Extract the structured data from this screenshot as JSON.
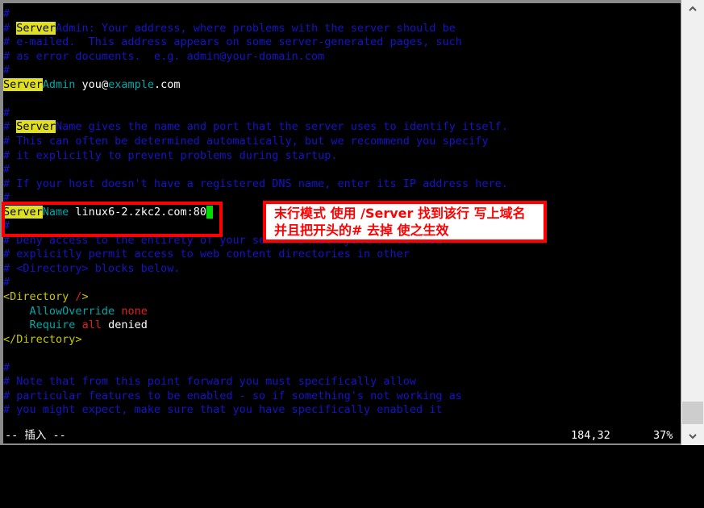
{
  "app": {
    "kind": "terminal-vim-editor",
    "background": "#000000",
    "comment_color": "#1414c8",
    "directive_color": "#00a8a8",
    "highlight_bg": "#e0e020",
    "cursor_color": "#00e000",
    "annotation_color": "#ff0000"
  },
  "editor": {
    "lines": [
      {
        "segs": [
          {
            "t": "#",
            "c": "comment"
          }
        ]
      },
      {
        "segs": [
          {
            "t": "# ",
            "c": "comment"
          },
          {
            "t": "Server",
            "c": "hl"
          },
          {
            "t": "Admin: Your address, where problems with the server should be",
            "c": "comment"
          }
        ]
      },
      {
        "segs": [
          {
            "t": "# e-mailed.  This address appears on some server-generated pages, such",
            "c": "comment"
          }
        ]
      },
      {
        "segs": [
          {
            "t": "# as error documents.  e.g. admin@your-domain.com",
            "c": "comment"
          }
        ]
      },
      {
        "segs": [
          {
            "t": "#",
            "c": "comment"
          }
        ]
      },
      {
        "segs": [
          {
            "t": "Server",
            "c": "hl"
          },
          {
            "t": "Admin",
            "c": "directive"
          },
          {
            "t": " you",
            "c": "white"
          },
          {
            "t": "@",
            "c": "white"
          },
          {
            "t": "example",
            "c": "directive"
          },
          {
            "t": ".com",
            "c": "white"
          }
        ]
      },
      {
        "segs": []
      },
      {
        "segs": [
          {
            "t": "#",
            "c": "comment"
          }
        ]
      },
      {
        "segs": [
          {
            "t": "# ",
            "c": "comment"
          },
          {
            "t": "Server",
            "c": "hl"
          },
          {
            "t": "Name gives the name and port that the server uses to identify itself.",
            "c": "comment"
          }
        ]
      },
      {
        "segs": [
          {
            "t": "# This can often be determined automatically, but we recommend you specify",
            "c": "comment"
          }
        ]
      },
      {
        "segs": [
          {
            "t": "# it explicitly to prevent problems during startup.",
            "c": "comment"
          }
        ]
      },
      {
        "segs": [
          {
            "t": "#",
            "c": "comment"
          }
        ]
      },
      {
        "segs": [
          {
            "t": "# If your host doesn't have a registered DNS name, enter its IP address here.",
            "c": "comment"
          }
        ]
      },
      {
        "segs": [
          {
            "t": "#",
            "c": "comment"
          }
        ]
      },
      {
        "segs": [
          {
            "t": "Server",
            "c": "hl"
          },
          {
            "t": "Name",
            "c": "directive"
          },
          {
            "t": " linux6-2.zkc2.com:80",
            "c": "white"
          },
          {
            "t": " ",
            "c": "cursor"
          }
        ]
      },
      {
        "segs": [
          {
            "t": "#",
            "c": "comment"
          }
        ]
      },
      {
        "segs": [
          {
            "t": "# Deny access to the entirety of your server's filesystem. You must",
            "c": "comment"
          }
        ]
      },
      {
        "segs": [
          {
            "t": "# explicitly permit access to web content directories in other",
            "c": "comment"
          }
        ]
      },
      {
        "segs": [
          {
            "t": "# <Directory> blocks below.",
            "c": "comment"
          }
        ]
      },
      {
        "segs": [
          {
            "t": "#",
            "c": "comment"
          }
        ]
      },
      {
        "segs": [
          {
            "t": "<Directory ",
            "c": "yellow"
          },
          {
            "t": "/",
            "c": "red"
          },
          {
            "t": ">",
            "c": "yellow"
          }
        ]
      },
      {
        "segs": [
          {
            "t": "    ",
            "c": "white"
          },
          {
            "t": "AllowOverride",
            "c": "directive"
          },
          {
            "t": " ",
            "c": "white"
          },
          {
            "t": "none",
            "c": "red"
          }
        ]
      },
      {
        "segs": [
          {
            "t": "    ",
            "c": "white"
          },
          {
            "t": "Require",
            "c": "directive"
          },
          {
            "t": " ",
            "c": "white"
          },
          {
            "t": "all",
            "c": "red"
          },
          {
            "t": " denied",
            "c": "white"
          }
        ]
      },
      {
        "segs": [
          {
            "t": "</Directory>",
            "c": "yellow"
          }
        ]
      },
      {
        "segs": []
      },
      {
        "segs": [
          {
            "t": "#",
            "c": "comment"
          }
        ]
      },
      {
        "segs": [
          {
            "t": "# Note that from this point forward you must specifically allow",
            "c": "comment"
          }
        ]
      },
      {
        "segs": [
          {
            "t": "# particular features to be enabled - so if something's not working as",
            "c": "comment"
          }
        ]
      },
      {
        "segs": [
          {
            "t": "# you might expect, make sure that you have specifically enabled it",
            "c": "comment"
          }
        ]
      }
    ]
  },
  "statusline": {
    "mode": "-- 插入 --",
    "position": "184,32",
    "percent": "37%"
  },
  "annotation": {
    "line1": "末行模式 使用 /Server 找到该行 写上域名",
    "line2": "并且把开头的# 去掉 使之生效"
  },
  "scrollbar": {
    "up_icon": "chevron-up-icon",
    "down_icon": "chevron-down-icon"
  }
}
